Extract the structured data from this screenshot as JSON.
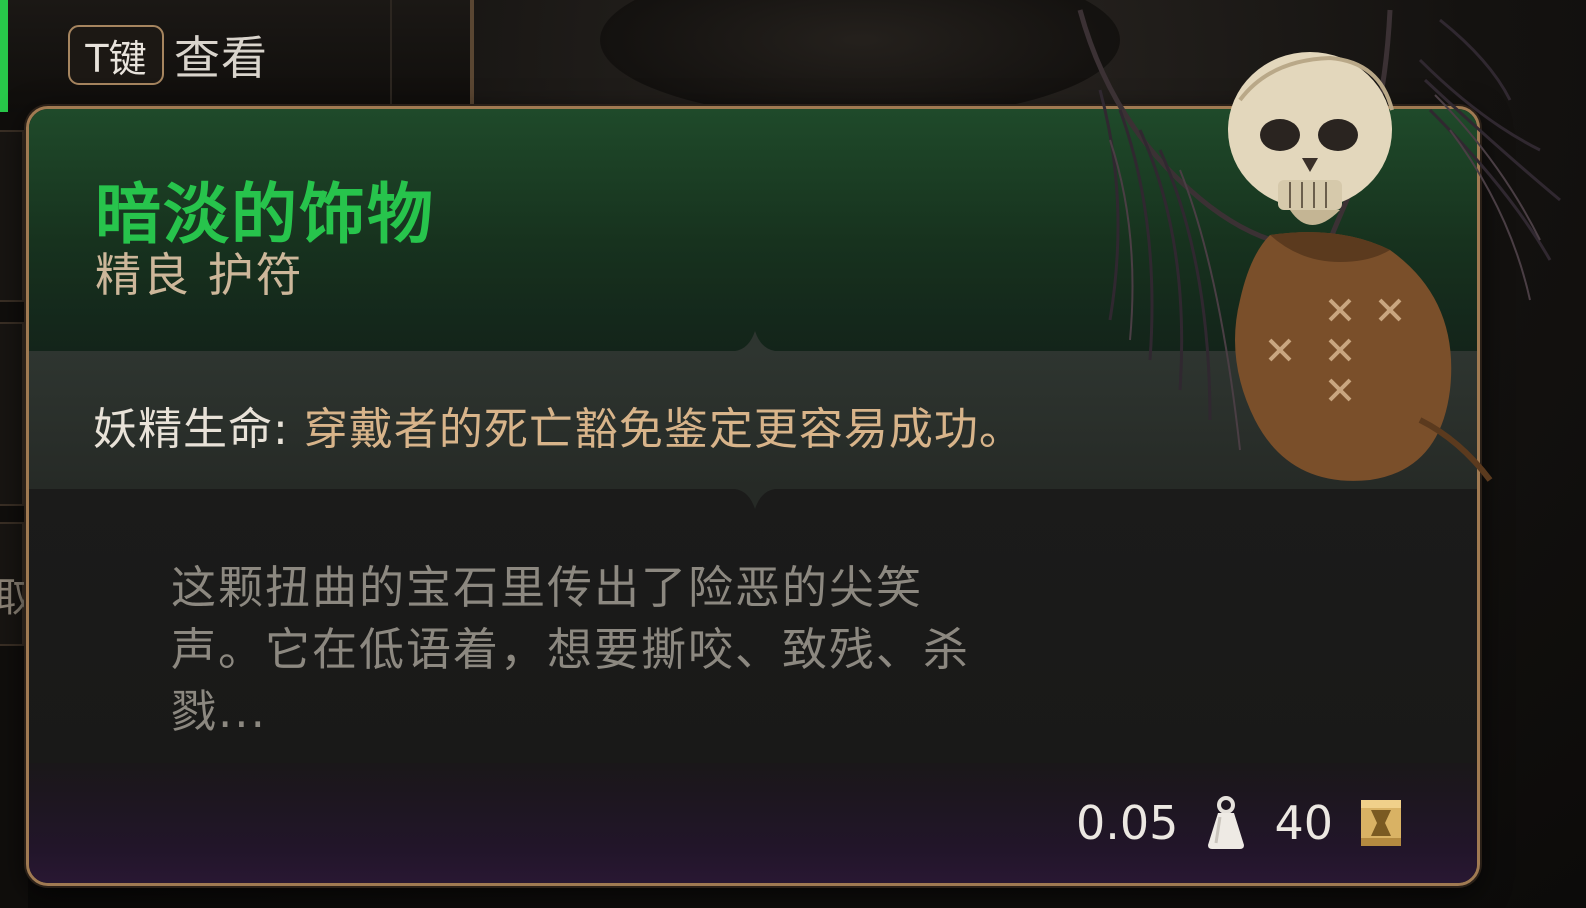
{
  "hint": {
    "key": "T键",
    "action": "查看"
  },
  "background": {
    "side_glyph": "取"
  },
  "item": {
    "name": "暗淡的饰物",
    "subtitle": "精良 护符",
    "rarity_color": "#27c44c",
    "property": {
      "name": "妖精生命:",
      "description": " 穿戴者的死亡豁免鉴定更容易成功。"
    },
    "lore": "这颗扭曲的宝石里传出了险恶的尖笑声。它在低语着，想要撕咬、致残、杀戮...",
    "weight": "0.05",
    "value": "40",
    "weight_icon": "weight-icon",
    "value_icon": "gold-coin-icon",
    "image": "skull-amulet-icon"
  }
}
